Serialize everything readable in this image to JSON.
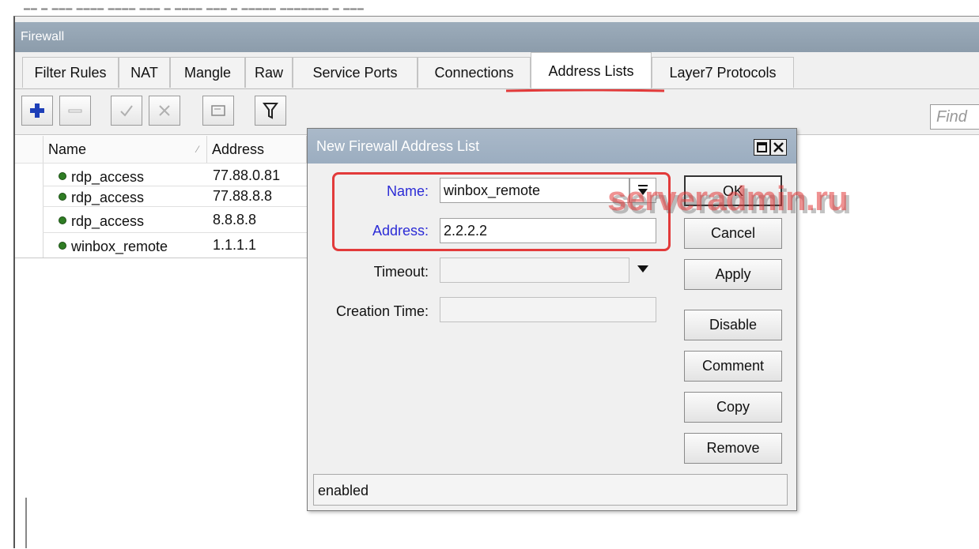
{
  "window": {
    "title": "Firewall"
  },
  "tabs": [
    {
      "label": "Filter Rules"
    },
    {
      "label": "NAT"
    },
    {
      "label": "Mangle"
    },
    {
      "label": "Raw"
    },
    {
      "label": "Service Ports"
    },
    {
      "label": "Connections"
    },
    {
      "label": "Address Lists",
      "active": true
    },
    {
      "label": "Layer7 Protocols"
    }
  ],
  "toolbar": {
    "icons": [
      "plus-icon",
      "minus-icon",
      "check-icon",
      "cross-icon",
      "comment-icon",
      "filter-icon"
    ],
    "find_placeholder": "Find"
  },
  "table": {
    "columns": [
      "Name",
      "Address"
    ],
    "rows": [
      {
        "name": "rdp_access",
        "address": "77.88.0.81"
      },
      {
        "name": "rdp_access",
        "address": "77.88.8.8"
      },
      {
        "name": "rdp_access",
        "address": "8.8.8.8"
      },
      {
        "name": "winbox_remote",
        "address": "1.1.1.1"
      }
    ]
  },
  "dialog": {
    "title": "New Firewall Address List",
    "fields": {
      "name_label": "Name:",
      "name_value": "winbox_remote",
      "address_label": "Address:",
      "address_value": "2.2.2.2",
      "timeout_label": "Timeout:",
      "timeout_value": "",
      "creation_label": "Creation Time:",
      "creation_value": ""
    },
    "buttons": {
      "ok": "OK",
      "cancel": "Cancel",
      "apply": "Apply",
      "disable": "Disable",
      "comment": "Comment",
      "copy": "Copy",
      "remove": "Remove"
    },
    "status": "enabled"
  },
  "watermark": "serveradmin.ru",
  "colors": {
    "highlight": "#e23a3a",
    "label_blue": "#2b2bd6",
    "enabled_dot": "#2f7d24"
  }
}
